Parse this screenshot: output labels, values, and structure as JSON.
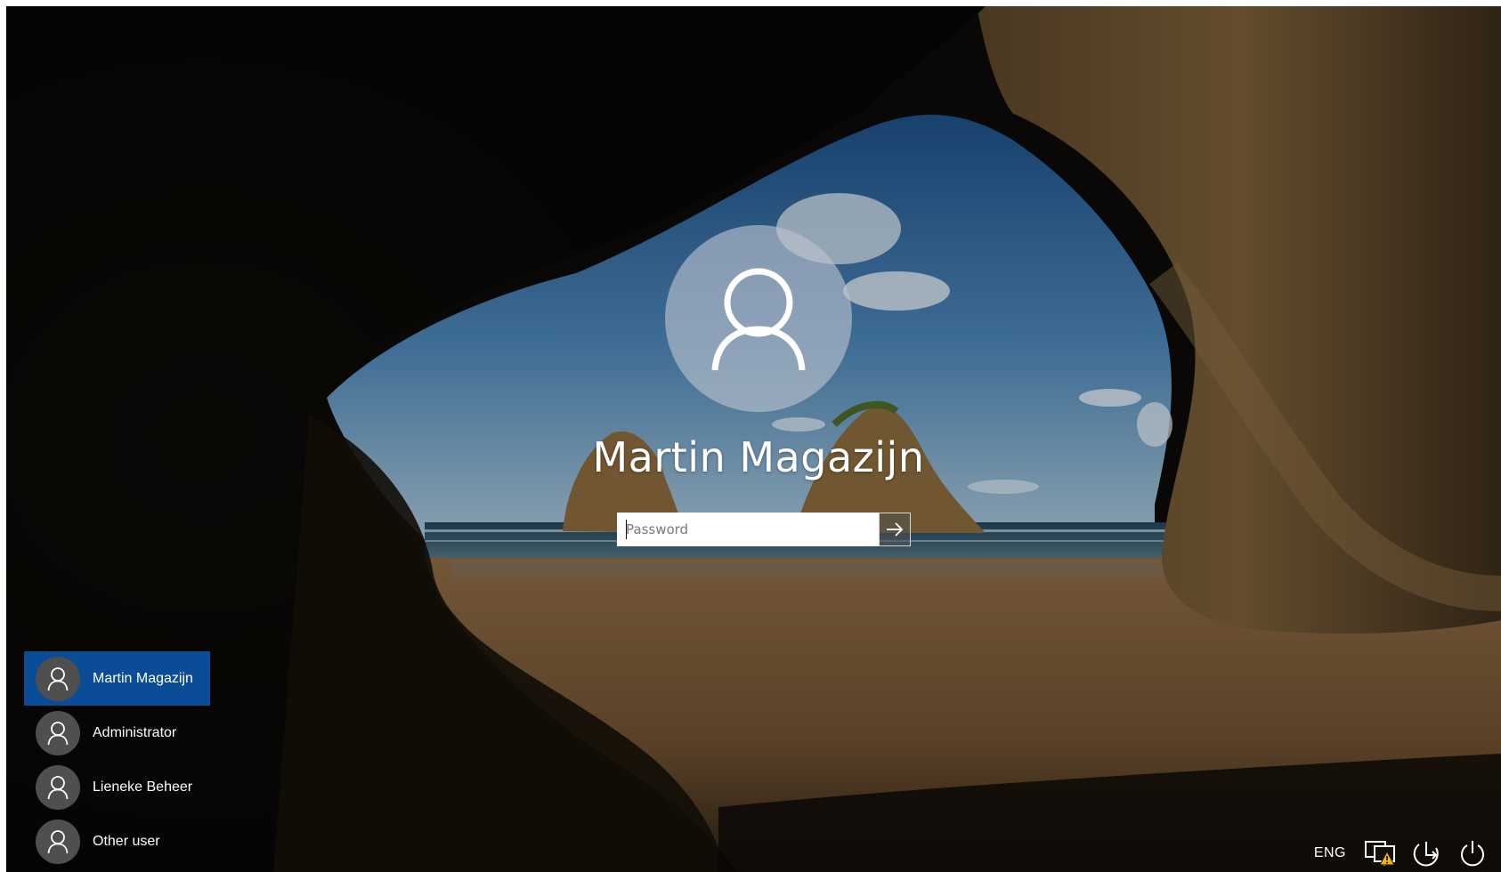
{
  "login": {
    "username": "Martin Magazijn",
    "password_placeholder": "Password",
    "password_value": ""
  },
  "users": [
    {
      "name": "Martin Magazijn",
      "selected": true
    },
    {
      "name": "Administrator",
      "selected": false
    },
    {
      "name": "Lieneke Beheer",
      "selected": false
    },
    {
      "name": "Other user",
      "selected": false
    }
  ],
  "tray": {
    "language": "ENG",
    "icons": [
      "network-warning-icon",
      "ease-of-access-icon",
      "power-icon"
    ]
  },
  "colors": {
    "selected_user_bg": "#0a4c96",
    "tile_avatar_bg": "#4f4f4f"
  }
}
